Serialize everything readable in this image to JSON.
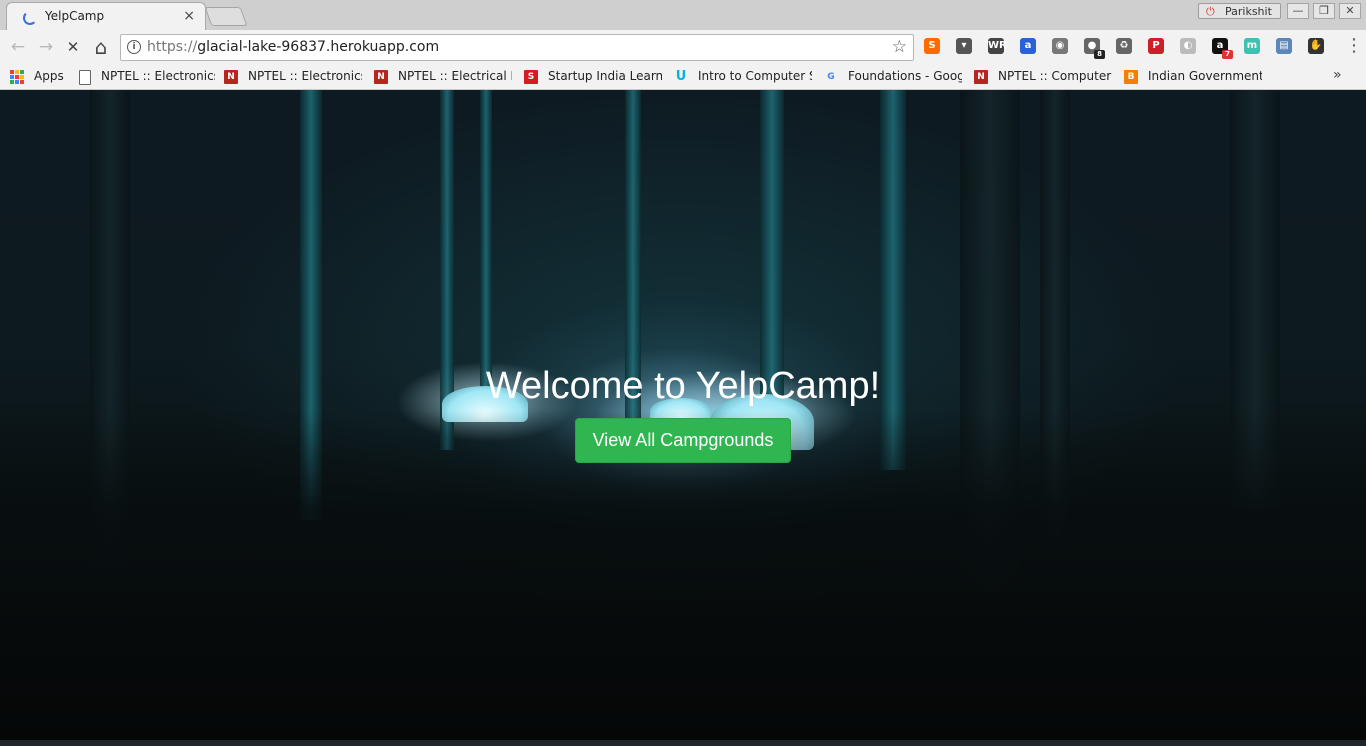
{
  "tab": {
    "title": "YelpCamp",
    "close": "×"
  },
  "profile": {
    "name": "Parikshit"
  },
  "window_controls": {
    "minimize": "—",
    "restore": "❐",
    "close": "✕"
  },
  "toolbar": {
    "back": "←",
    "forward": "→",
    "stop": "✕",
    "home": "⌂",
    "url_scheme": "https://",
    "url_host": "glacial-lake-96837.herokuapp.com",
    "star": "☆",
    "menu": "⋮"
  },
  "extensions": [
    {
      "name": "stylish-icon",
      "label": "S",
      "color": "#ff6a00"
    },
    {
      "name": "pocket-icon",
      "label": "▾",
      "color": "#555555"
    },
    {
      "name": "wr-icon",
      "label": "WR",
      "color": "#444444"
    },
    {
      "name": "a-circle-icon",
      "label": "a",
      "color": "#2a62d6"
    },
    {
      "name": "camera-icon",
      "label": "◉",
      "color": "#777777"
    },
    {
      "name": "ghostery-icon",
      "label": "●",
      "color": "#666666",
      "badge": "8"
    },
    {
      "name": "recycle-icon",
      "label": "♻",
      "color": "#666666"
    },
    {
      "name": "pinterest-icon",
      "label": "P",
      "color": "#cb2027"
    },
    {
      "name": "feather-icon",
      "label": "◐",
      "color": "#bbbbbb"
    },
    {
      "name": "amazon-icon",
      "label": "a",
      "color": "#111111",
      "badge": "7"
    },
    {
      "name": "m-icon",
      "label": "m",
      "color": "#40c0b0"
    },
    {
      "name": "screen-icon",
      "label": "▤",
      "color": "#5a86b8"
    },
    {
      "name": "gnome-icon",
      "label": "✋",
      "color": "#333333"
    }
  ],
  "bookmarks": {
    "apps_label": "Apps",
    "more": "»",
    "items": [
      {
        "label": "NPTEL :: Electronics",
        "icon": "page-icon",
        "icon_text": "",
        "color": "#ffffff"
      },
      {
        "label": "NPTEL :: Electronics",
        "icon": "nptel-icon",
        "icon_text": "N",
        "color": "#b5271e"
      },
      {
        "label": "NPTEL :: Electrical Er",
        "icon": "nptel-icon",
        "icon_text": "N",
        "color": "#b5271e"
      },
      {
        "label": "Startup India Learnin",
        "icon": "startup-india-icon",
        "icon_text": "S",
        "color": "#d71920"
      },
      {
        "label": "Intro to Computer Sc",
        "icon": "udacity-icon",
        "icon_text": "U",
        "color": "#02b3e4"
      },
      {
        "label": "Foundations - Googl",
        "icon": "google-icon",
        "icon_text": "G",
        "color": "#4285f4"
      },
      {
        "label": "NPTEL :: Computer S",
        "icon": "nptel-icon",
        "icon_text": "N",
        "color": "#b5271e"
      },
      {
        "label": "Indian Government",
        "icon": "blogger-icon",
        "icon_text": "B",
        "color": "#f57d00"
      }
    ]
  },
  "landing": {
    "title": "Welcome to YelpCamp!",
    "button": "View All Campgrounds",
    "button_color": "#2fb650"
  }
}
